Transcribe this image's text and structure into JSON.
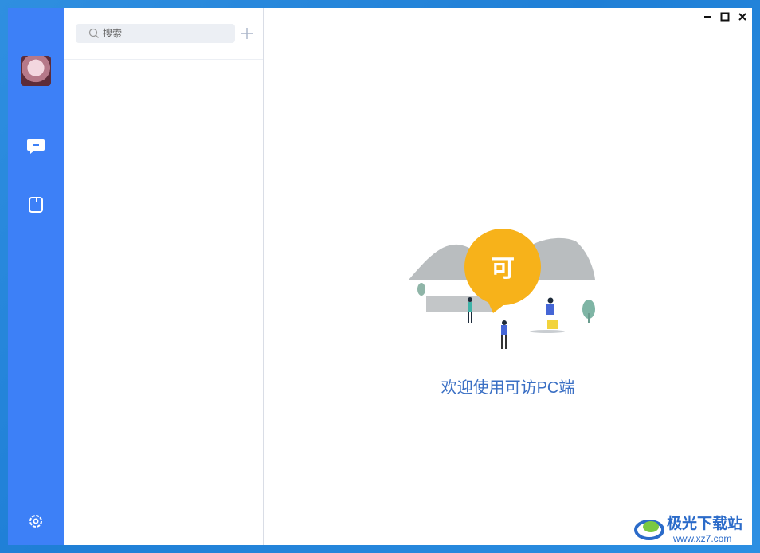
{
  "sidebar": {
    "avatar": "user-avatar",
    "items": [
      {
        "name": "chat",
        "icon": "chat-bubble-icon"
      },
      {
        "name": "contacts",
        "icon": "contacts-icon"
      }
    ],
    "settings_icon": "gear-icon"
  },
  "search": {
    "placeholder": "搜索",
    "add_icon": "plus-icon"
  },
  "window_controls": [
    "minimize-icon",
    "maximize-icon",
    "close-icon"
  ],
  "main": {
    "logo_char": "可",
    "welcome_text": "欢迎使用可访PC端"
  },
  "watermark": {
    "title": "极光下载站",
    "url": "www.xz7.com"
  },
  "colors": {
    "sidebar": "#3d80f7",
    "welcome_text": "#3a6fc4",
    "logo_bubble": "#f7b21a"
  }
}
